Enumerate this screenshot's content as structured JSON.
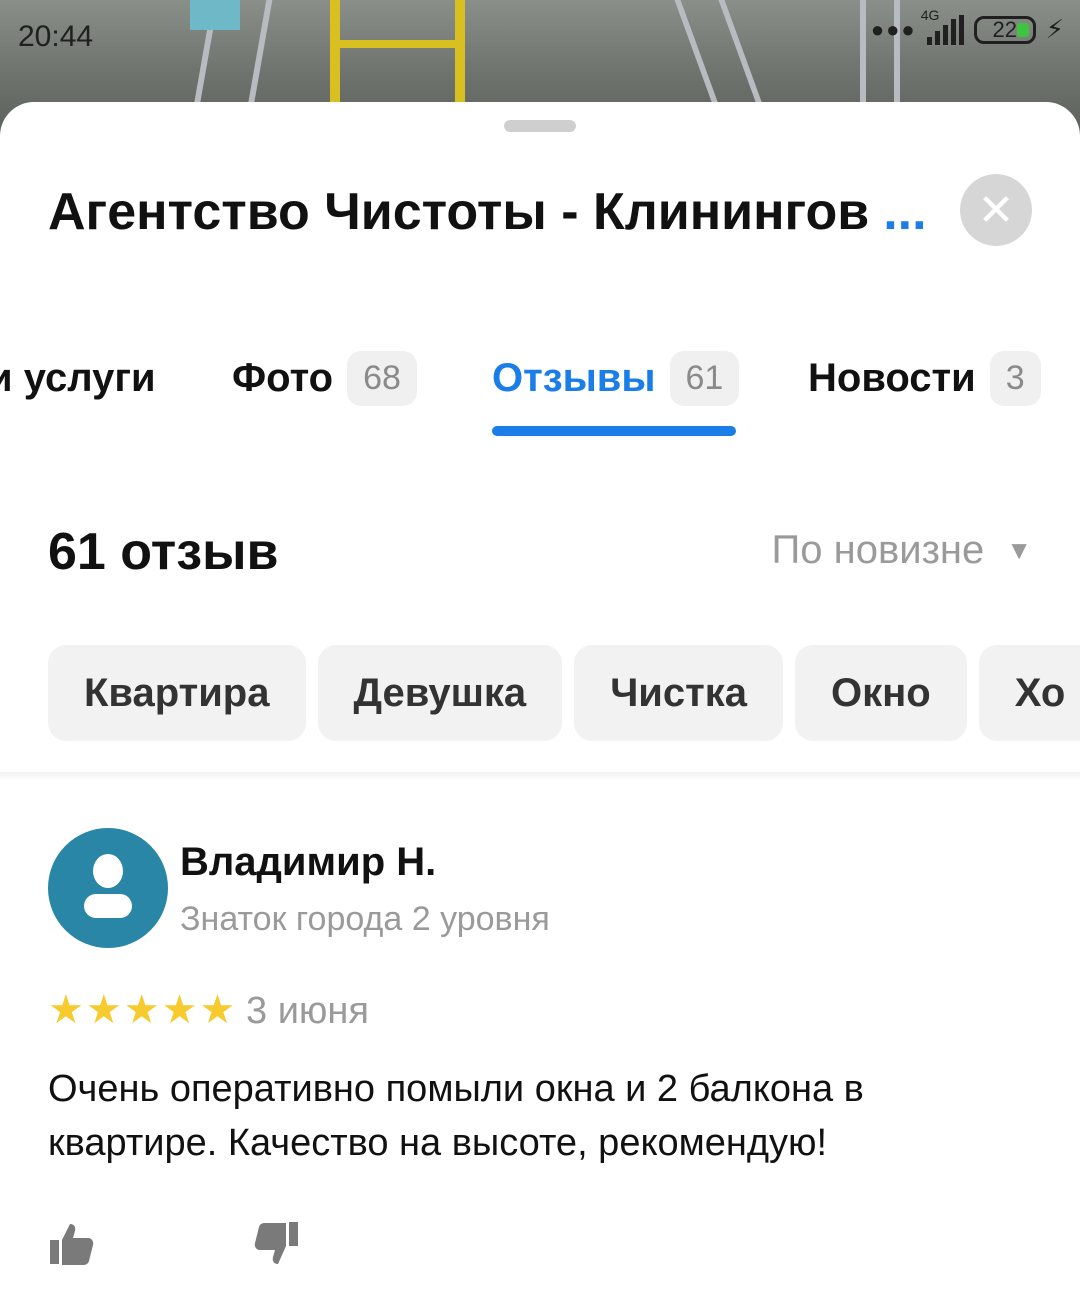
{
  "status_bar": {
    "time": "20:44",
    "network": "4G",
    "battery": "22"
  },
  "header": {
    "title": "Агентство Чистоты - Клинингов",
    "title_more": "...",
    "close_icon": "close-icon"
  },
  "tabs": [
    {
      "label": "и услуги",
      "count": ""
    },
    {
      "label": "Фото",
      "count": "68"
    },
    {
      "label": "Отзывы",
      "count": "61"
    },
    {
      "label": "Новости",
      "count": "3"
    }
  ],
  "reviews_header": {
    "count_label": "61 отзыв",
    "sort_label": "По новизне"
  },
  "filter_chips": [
    "Квартира",
    "Девушка",
    "Чистка",
    "Окно",
    "Хо"
  ],
  "review": {
    "author": "Владимир Н.",
    "author_level": "Знаток города 2 уровня",
    "rating": 5,
    "date": "3 июня",
    "text": "Очень оперативно помыли окна и 2 балкона в квартире. Качество на высоте, рекомендую!"
  },
  "colors": {
    "accent": "#1a7de8",
    "star": "#f7cb2d",
    "avatar": "#2a86a6"
  }
}
